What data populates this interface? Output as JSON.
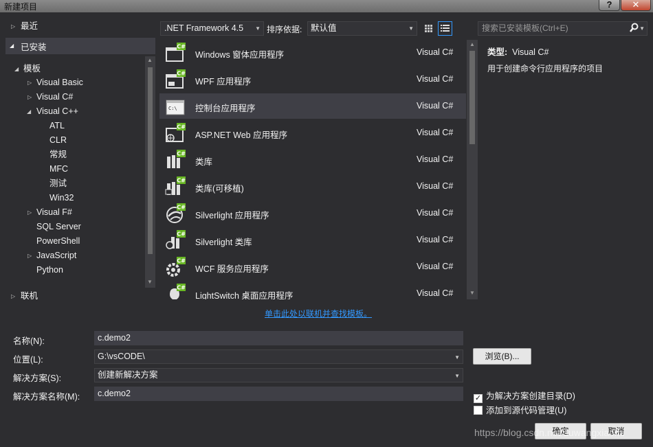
{
  "window": {
    "title": "新建项目",
    "help_label": "?",
    "close_label": "✕"
  },
  "tree": {
    "recent": "最近",
    "installed": "已安装",
    "templates": "模板",
    "visual_basic": "Visual Basic",
    "visual_csharp": "Visual C#",
    "visual_cpp": "Visual C++",
    "cpp_children": [
      "ATL",
      "CLR",
      "常规",
      "MFC",
      "测试",
      "Win32"
    ],
    "visual_fsharp": "Visual F#",
    "sql_server": "SQL Server",
    "powershell": "PowerShell",
    "javascript": "JavaScript",
    "python": "Python",
    "online": "联机"
  },
  "toolbar": {
    "framework": ".NET Framework 4.5",
    "sort_label": "排序依据:",
    "sort_value": "默认值",
    "search_placeholder": "搜索已安装模板(Ctrl+E)"
  },
  "templates": [
    {
      "name": "Windows 窗体应用程序",
      "lang": "Visual C#",
      "icon": "windows-forms-icon"
    },
    {
      "name": "WPF 应用程序",
      "lang": "Visual C#",
      "icon": "wpf-app-icon"
    },
    {
      "name": "控制台应用程序",
      "lang": "Visual C#",
      "icon": "console-app-icon"
    },
    {
      "name": "ASP.NET Web 应用程序",
      "lang": "Visual C#",
      "icon": "asp-net-icon"
    },
    {
      "name": "类库",
      "lang": "Visual C#",
      "icon": "class-library-icon"
    },
    {
      "name": "类库(可移植)",
      "lang": "Visual C#",
      "icon": "portable-library-icon"
    },
    {
      "name": "Silverlight 应用程序",
      "lang": "Visual C#",
      "icon": "silverlight-app-icon"
    },
    {
      "name": "Silverlight 类库",
      "lang": "Visual C#",
      "icon": "silverlight-library-icon"
    },
    {
      "name": "WCF 服务应用程序",
      "lang": "Visual C#",
      "icon": "wcf-service-icon"
    },
    {
      "name": "LightSwitch 桌面应用程序",
      "lang": "Visual C#",
      "icon": "lightswitch-icon"
    }
  ],
  "info": {
    "type_label": "类型:",
    "type_value": "Visual C#",
    "description": "用于创建命令行应用程序的项目"
  },
  "online_link": "单击此处以联机并查找模板。",
  "form": {
    "name_label": "名称(N):",
    "name_value": "c.demo2",
    "location_label": "位置(L):",
    "location_value": "G:\\vsCODE\\",
    "solution_label": "解决方案(S):",
    "solution_value": "创建新解决方案",
    "solution_name_label": "解决方案名称(M):",
    "solution_name_value": "c.demo2",
    "browse_label": "浏览(B)...",
    "create_dir_label": "为解决方案创建目录(D)",
    "create_dir_checked": "✓",
    "source_control_label": "添加到源代码管理(U)",
    "ok_label": "确定",
    "cancel_label": "取消"
  },
  "watermark": "https://blog.csdn.net/duwangxiaomi",
  "colors": {
    "background": "#2d2d30",
    "selection": "#3f3f46",
    "accent": "#3399ff",
    "csharp_badge": "#68b723"
  }
}
